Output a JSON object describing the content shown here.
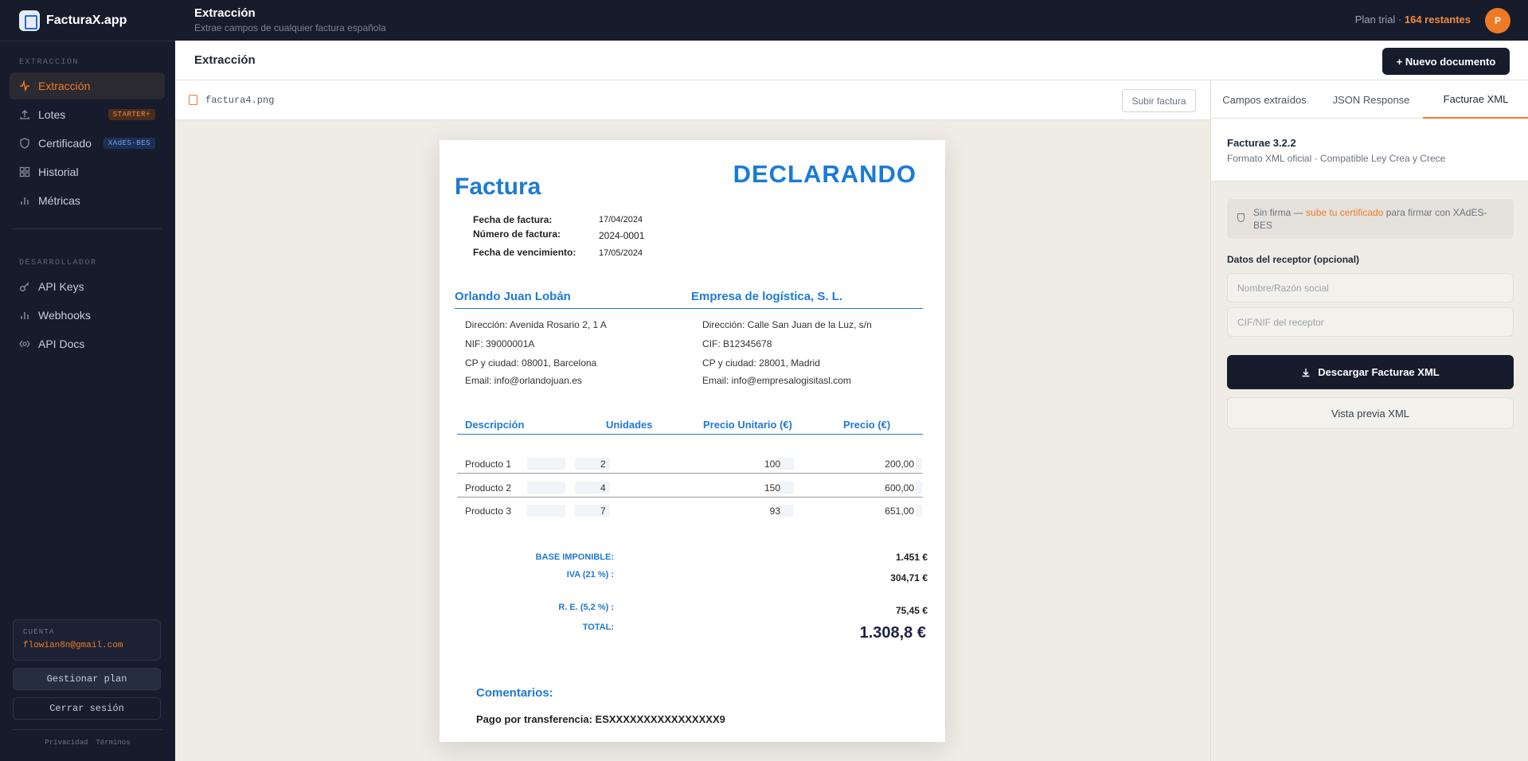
{
  "app": {
    "brand": "FacturaX.app"
  },
  "sidebar": {
    "section_extraction": "EXTRACCIÓN",
    "section_developer": "DESARROLLADOR",
    "items": [
      {
        "label": "Extracción",
        "icon": "activity-icon",
        "active": true
      },
      {
        "label": "Lotes",
        "icon": "upload-icon",
        "badge": "STARTER+"
      },
      {
        "label": "Certificado",
        "icon": "shield-icon",
        "badge": "XAdES-BES"
      },
      {
        "label": "Historial",
        "icon": "grid-icon"
      },
      {
        "label": "Métricas",
        "icon": "bar-chart-icon"
      }
    ],
    "dev_items": [
      {
        "label": "API Keys",
        "icon": "key-icon"
      },
      {
        "label": "Webhooks",
        "icon": "bar-chart-icon"
      },
      {
        "label": "API Docs",
        "icon": "code-icon"
      }
    ],
    "account_label": "CUENTA",
    "account_email": "flowian8n@gmail.com",
    "manage_plan": "Gestionar plan",
    "logout": "Cerrar sesión",
    "privacy": "Privacidad",
    "terms": "Términos"
  },
  "topbar": {
    "title": "Extracción",
    "subtitle": "Extrae campos de cualquier factura española",
    "plan_prefix": "Plan trial · ",
    "plan_remaining": "164 restantes",
    "avatar_initial": "P"
  },
  "page": {
    "title": "Extracción",
    "new_doc": "+ Nuevo documento"
  },
  "file": {
    "name": "factura4.png",
    "upload": "Subir factura"
  },
  "invoice": {
    "title": "Factura",
    "logo": "DECLARANDO",
    "meta": [
      {
        "label": "Fecha de factura:",
        "value": "17/04/2024"
      },
      {
        "label": "Número de factura:",
        "value": "2024-0001"
      },
      {
        "label": "Fecha de vencimiento:",
        "value": "17/05/2024"
      }
    ],
    "issuer": {
      "name": "Orlando Juan Lobán",
      "address": "Dirección: Avenida Rosario 2, 1 A",
      "tax_id": "NIF: 39000001A",
      "city": "CP y ciudad: 08001, Barcelona",
      "email": "Email: info@orlandojuan.es"
    },
    "client": {
      "name": "Empresa de logística, S. L.",
      "address": "Dirección: Calle San Juan de la Luz, s/n",
      "tax_id": "CIF: B12345678",
      "city": "CP y ciudad: 28001, Madrid",
      "email": "Email: info@empresalogisitasl.com"
    },
    "headers": {
      "desc": "Descripción",
      "units": "Unidades",
      "unit_price": "Precio Unitario (€)",
      "price": "Precio (€)"
    },
    "rows": [
      {
        "desc": "Producto 1",
        "units": "2",
        "unit_price": "100",
        "price": "200,00"
      },
      {
        "desc": "Producto 2",
        "units": "4",
        "unit_price": "150",
        "price": "600,00"
      },
      {
        "desc": "Producto 3",
        "units": "7",
        "unit_price": "93",
        "price": "651,00"
      }
    ],
    "totals": {
      "base_label": "BASE IMPONIBLE:",
      "base_value": "1.451 €",
      "iva_label": "IVA (21 %) :",
      "iva_value": "304,71 €",
      "re_label": "R. E. (5,2 %) :",
      "re_value": "75,45 €",
      "total_label": "TOTAL:",
      "total_value": "1.308,8 €"
    },
    "comments_label": "Comentarios:",
    "payment": "Pago por transferencia: ESXXXXXXXXXXXXXXXX9"
  },
  "panel": {
    "tabs": [
      "Campos extraídos",
      "JSON Response",
      "Facturae XML"
    ],
    "active_tab": "Facturae XML",
    "title": "Facturae 3.2.2",
    "subtitle": "Formato XML oficial · Compatible Ley Crea y Crece",
    "warn_prefix": "Sin firma — ",
    "warn_link": "sube tu certificado",
    "warn_suffix": " para firmar con XAdES-BES",
    "receiver_label": "Datos del receptor (opcional)",
    "name_placeholder": "Nombre/Razón social",
    "cif_placeholder": "CIF/NIF del receptor",
    "download": "Descargar Facturae XML",
    "preview": "Vista previa XML"
  }
}
